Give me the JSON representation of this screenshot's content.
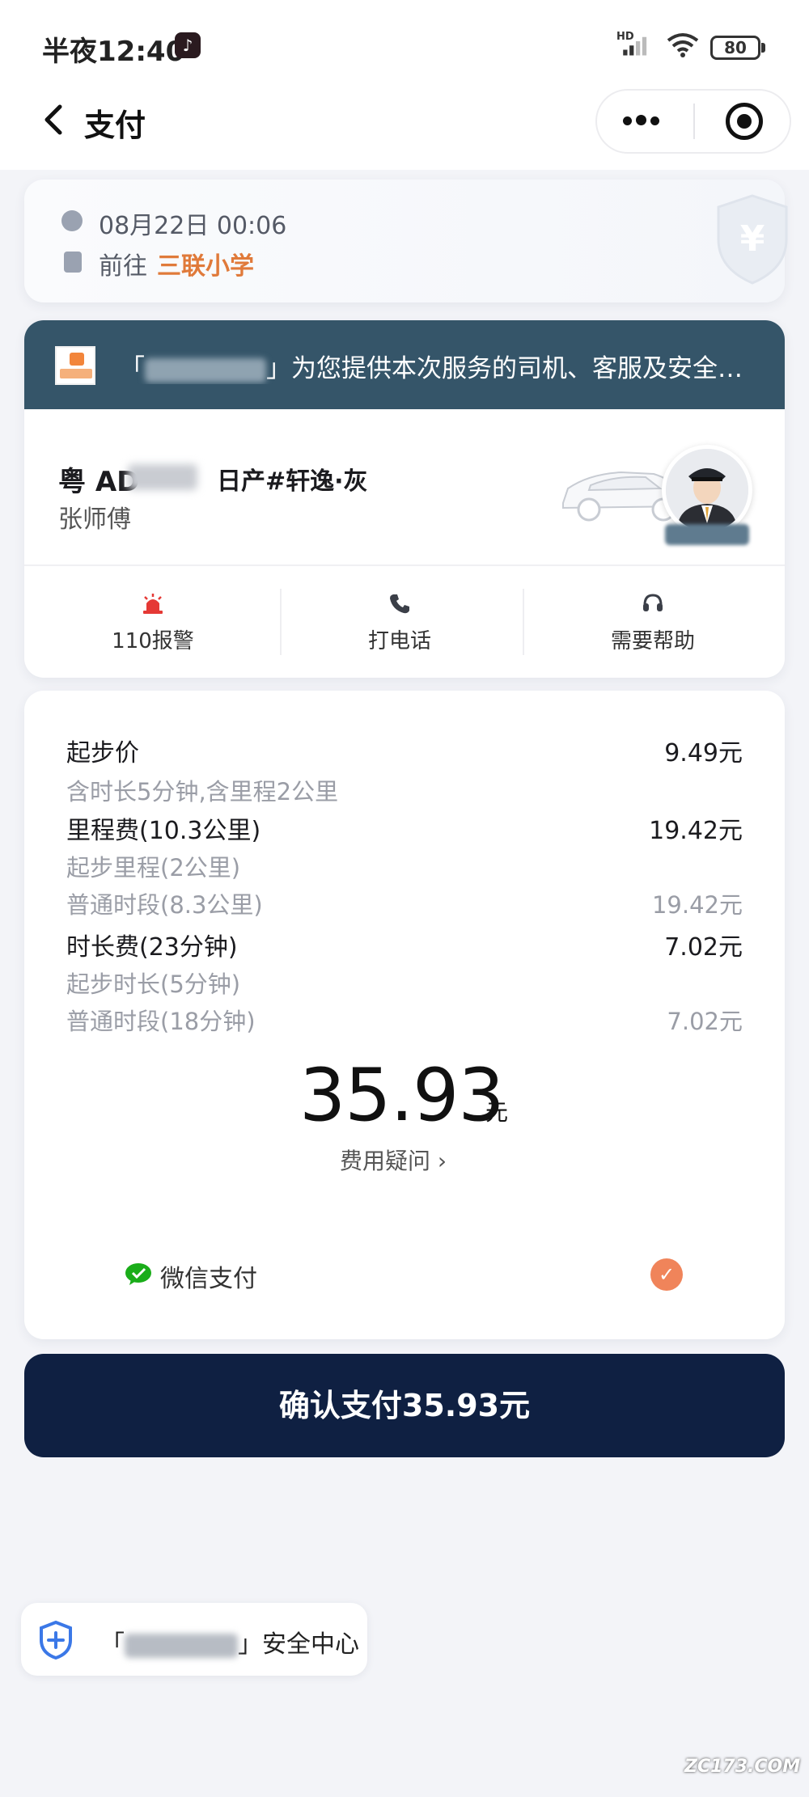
{
  "status_bar": {
    "time": "半夜12:40",
    "battery": "80",
    "network": "HD"
  },
  "nav": {
    "back": "‹",
    "title": "支付"
  },
  "trip": {
    "time": "08月22日 00:06",
    "dest_label": "前往",
    "dest": "三联小学"
  },
  "driver": {
    "banner_prefix": "「",
    "banner_suffix": "」为您提供本次服务的司机、客服及安全…",
    "plate_prefix": "粤 AD",
    "car_model": "日产#轩逸·灰",
    "name": "张师傅",
    "actions": [
      {
        "label": "110报警",
        "icon": "alarm-icon"
      },
      {
        "label": "打电话",
        "icon": "phone-icon"
      },
      {
        "label": "需要帮助",
        "icon": "headset-icon"
      }
    ]
  },
  "fees": {
    "items": [
      {
        "label": "起步价",
        "value": "9.49元",
        "kind": "main"
      },
      {
        "label": "含时长5分钟,含里程2公里",
        "value": "",
        "kind": "sub"
      },
      {
        "label": "里程费(10.3公里)",
        "value": "19.42元",
        "kind": "main"
      },
      {
        "label": "起步里程(2公里)",
        "value": "",
        "kind": "sub"
      },
      {
        "label": "普通时段(8.3公里)",
        "value": "19.42元",
        "kind": "sub"
      },
      {
        "label": "时长费(23分钟)",
        "value": "7.02元",
        "kind": "main"
      },
      {
        "label": "起步时长(5分钟)",
        "value": "",
        "kind": "sub"
      },
      {
        "label": "普通时段(18分钟)",
        "value": "7.02元",
        "kind": "sub"
      }
    ],
    "total": "35.93",
    "total_unit": "元",
    "question": "费用疑问 ›"
  },
  "payment": {
    "method": "微信支付",
    "selected": true,
    "check_glyph": "✓"
  },
  "pay_button": "确认支付35.93元",
  "safety": {
    "prefix": "「",
    "suffix": "」安全中心"
  },
  "watermark": "ZC173.COM",
  "colors": {
    "accent": "#e07a3a",
    "banner": "#355569",
    "pay_button": "#0f2042",
    "check": "#f0845a",
    "alarm": "#e53935",
    "wechat": "#1aad19"
  }
}
